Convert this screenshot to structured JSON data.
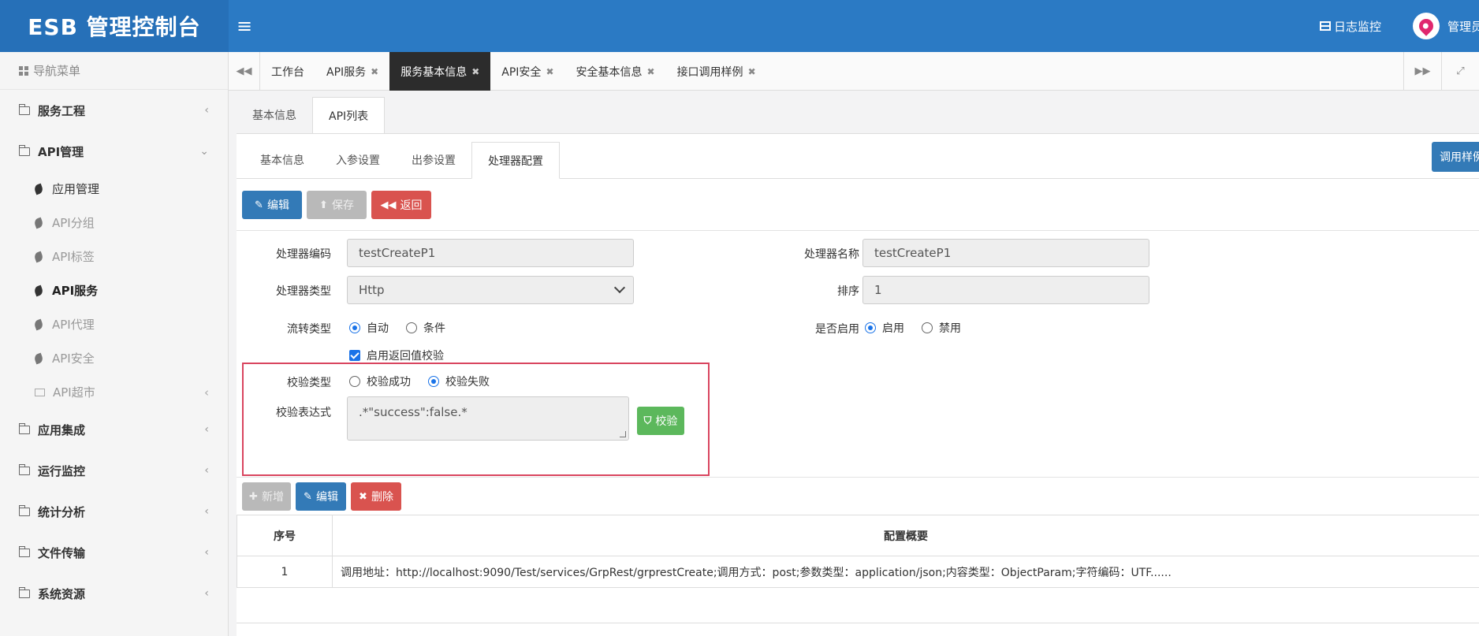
{
  "header": {
    "brand": "ESB 管理控制台",
    "menu_toggle": "≡",
    "log_monitor": "日志监控",
    "admin": "管理员"
  },
  "sidebar": {
    "title": "导航菜单",
    "items": [
      {
        "label": "服务工程"
      },
      {
        "label": "API管理"
      },
      {
        "label": "应用集成"
      },
      {
        "label": "运行监控"
      },
      {
        "label": "统计分析"
      },
      {
        "label": "文件传输"
      },
      {
        "label": "系统资源"
      }
    ],
    "api_sub": [
      {
        "label": "应用管理"
      },
      {
        "label": "API分组"
      },
      {
        "label": "API标签"
      },
      {
        "label": "API服务"
      },
      {
        "label": "API代理"
      },
      {
        "label": "API安全"
      },
      {
        "label": "API超市"
      }
    ]
  },
  "tabs": [
    {
      "label": "工作台"
    },
    {
      "label": "API服务"
    },
    {
      "label": "服务基本信息"
    },
    {
      "label": "API安全"
    },
    {
      "label": "安全基本信息"
    },
    {
      "label": "接口调用样例"
    }
  ],
  "outer_tabs": [
    {
      "label": "基本信息"
    },
    {
      "label": "API列表"
    }
  ],
  "inner_tabs": [
    {
      "label": "基本信息"
    },
    {
      "label": "入参设置"
    },
    {
      "label": "出参设置"
    },
    {
      "label": "处理器配置"
    }
  ],
  "call_sample": "调用样例",
  "toolbar": {
    "edit": "编辑",
    "save": "保存",
    "back": "返回"
  },
  "form": {
    "code_label": "处理器编码",
    "code_value": "testCreateP1",
    "name_label": "处理器名称",
    "name_value": "testCreateP1",
    "type_label": "处理器类型",
    "type_value": "Http",
    "order_label": "排序",
    "order_value": "1",
    "flow_label": "流转类型",
    "flow_auto": "自动",
    "flow_cond": "条件",
    "enable_label": "是否启用",
    "enable_on": "启用",
    "enable_off": "禁用",
    "check_enable": "启用返回值校验",
    "check_type_label": "校验类型",
    "check_success": "校验成功",
    "check_fail": "校验失败",
    "expr_label": "校验表达式",
    "expr_value": ".*\"success\":false.*",
    "verify_btn": "校验"
  },
  "table_toolbar": {
    "add": "新增",
    "edit": "编辑",
    "delete": "删除"
  },
  "table": {
    "col_no": "序号",
    "col_summary": "配置概要",
    "rows": [
      {
        "no": "1",
        "summary": "调用地址：http://localhost:9090/Test/services/GrpRest/grprestCreate;调用方式：post;参数类型：application/json;内容类型：ObjectParam;字符编码：UTF......"
      }
    ]
  }
}
